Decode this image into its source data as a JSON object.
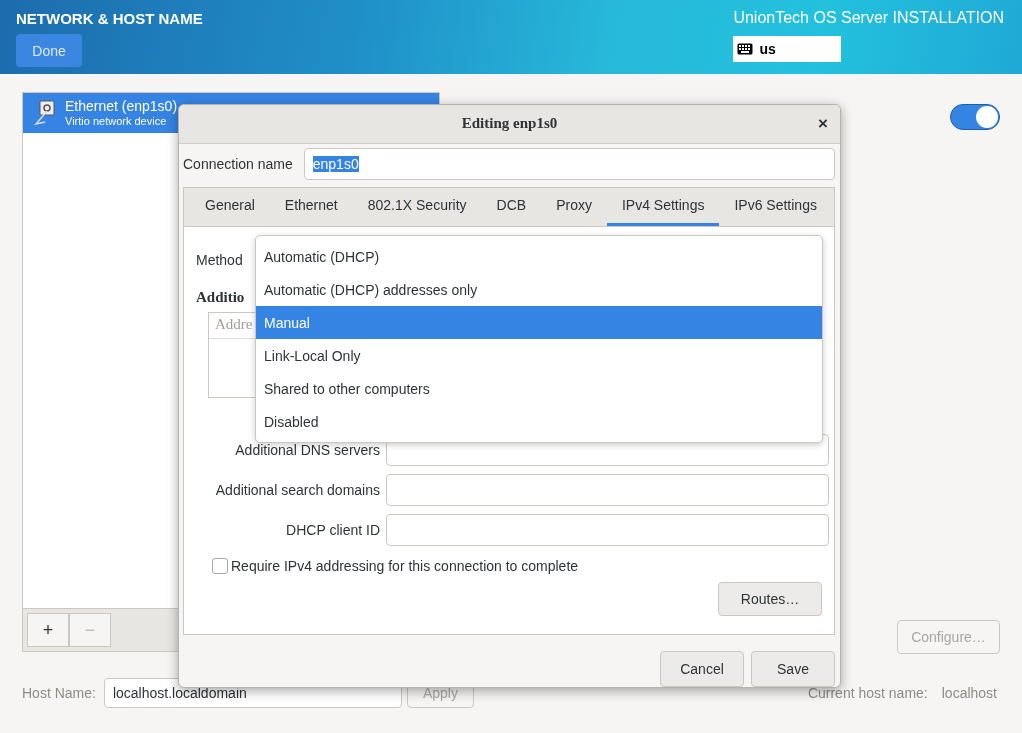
{
  "header": {
    "title": "NETWORK & HOST NAME",
    "done_button": "Done",
    "product": "UnionTech OS Server INSTALLATION",
    "keyboard_layout": "us"
  },
  "devices": [
    {
      "name": "Ethernet (enp1s0)",
      "description": "Virtio network device",
      "selected": true
    }
  ],
  "device_toolbar": [
    {
      "label": "+",
      "disabled": false
    },
    {
      "label": "−",
      "disabled": true
    }
  ],
  "device_switch": {
    "on": true
  },
  "configure_button": {
    "label": "Configure…",
    "disabled": true
  },
  "hostname": {
    "label": "Host Name:",
    "value": "localhost.localdomain",
    "apply": "Apply",
    "apply_disabled": true,
    "current_label": "Current host name:",
    "current_value": "localhost"
  },
  "dialog": {
    "title": "Editing enp1s0",
    "close": "×",
    "connection_label": "Connection name",
    "connection_value": "enp1s0",
    "connection_value_selected": true,
    "tabs": [
      {
        "label": "General",
        "selected": false
      },
      {
        "label": "Ethernet",
        "selected": false
      },
      {
        "label": "802.1X Security",
        "selected": false
      },
      {
        "label": "DCB",
        "selected": false
      },
      {
        "label": "Proxy",
        "selected": false
      },
      {
        "label": "IPv4 Settings",
        "selected": true
      },
      {
        "label": "IPv6 Settings",
        "selected": false
      }
    ],
    "method_label": "Method",
    "addresses_heading": "Additio",
    "address_column": "Addre",
    "fields": [
      {
        "label": "Additional DNS servers"
      },
      {
        "label": "Additional search domains"
      },
      {
        "label": "DHCP client ID"
      }
    ],
    "require_checkbox": {
      "label": "Require IPv4 addressing for this connection to complete",
      "checked": false
    },
    "routes_button": "Routes…",
    "buttons": [
      "Cancel",
      "Save"
    ]
  },
  "method_menu": [
    {
      "label": "Automatic (DHCP)",
      "selected": false
    },
    {
      "label": "Automatic (DHCP) addresses only",
      "selected": false
    },
    {
      "label": "Manual",
      "selected": true
    },
    {
      "label": "Link-Local Only",
      "selected": false
    },
    {
      "label": "Shared to other computers",
      "selected": false
    },
    {
      "label": "Disabled",
      "selected": false
    }
  ]
}
